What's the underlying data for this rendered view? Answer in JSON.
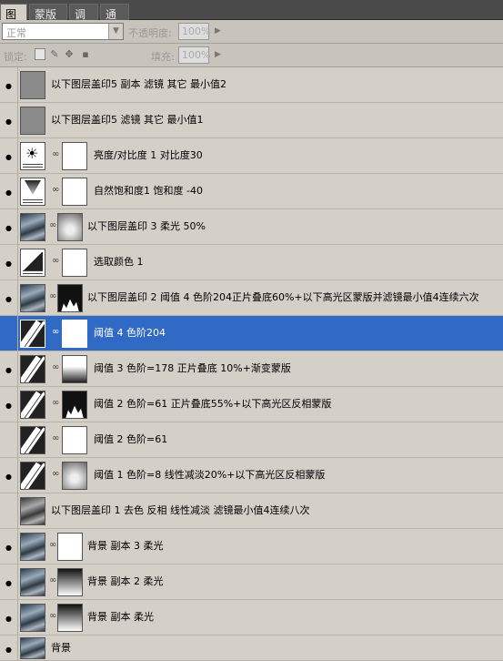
{
  "tabs": [
    "图层",
    "蒙版",
    "调整",
    "通道"
  ],
  "toolbar": {
    "blend_mode": "正常",
    "opacity_label": "不透明度:",
    "opacity_value": "100%",
    "lock_label": "锁定:",
    "fill_label": "填充:",
    "fill_value": "100%"
  },
  "layers": [
    {
      "name": "以下图层盖印5 副本 滤镜 其它 最小值2",
      "visible": true,
      "selected": false
    },
    {
      "name": "以下图层盖印5 滤镜 其它 最小值1",
      "visible": true,
      "selected": false
    },
    {
      "name": "亮度/对比度 1  对比度30",
      "visible": true,
      "selected": false
    },
    {
      "name": "自然饱和度1  饱和度 -40",
      "visible": true,
      "selected": false
    },
    {
      "name": "以下图层盖印 3  柔光 50%",
      "visible": true,
      "selected": false
    },
    {
      "name": "选取颜色 1",
      "visible": true,
      "selected": false
    },
    {
      "name": "以下图层盖印 2 阈值 4 色阶204正片叠底60%+以下高光区蒙版并滤镜最小值4连续六次",
      "visible": true,
      "selected": false
    },
    {
      "name": "阈值 4 色阶204",
      "visible": false,
      "selected": true
    },
    {
      "name": "阈值 3 色阶=178  正片叠底 10%+渐变蒙版",
      "visible": true,
      "selected": false
    },
    {
      "name": "阈值 2  色阶=61  正片叠底55%+以下高光区反相蒙版",
      "visible": true,
      "selected": false
    },
    {
      "name": "阈值 2 色阶=61",
      "visible": false,
      "selected": false
    },
    {
      "name": "阈值 1 色阶=8  线性减淡20%+以下高光区反相蒙版",
      "visible": true,
      "selected": false
    },
    {
      "name": "以下图层盖印 1  去色  反相  线性减淡  滤镜最小值4连续八次",
      "visible": false,
      "selected": false
    },
    {
      "name": "背景 副本 3 柔光",
      "visible": true,
      "selected": false
    },
    {
      "name": "背景 副本 2  柔光",
      "visible": true,
      "selected": false
    },
    {
      "name": "背景 副本 柔光",
      "visible": true,
      "selected": false
    },
    {
      "name": "背景",
      "visible": true,
      "selected": false
    }
  ]
}
